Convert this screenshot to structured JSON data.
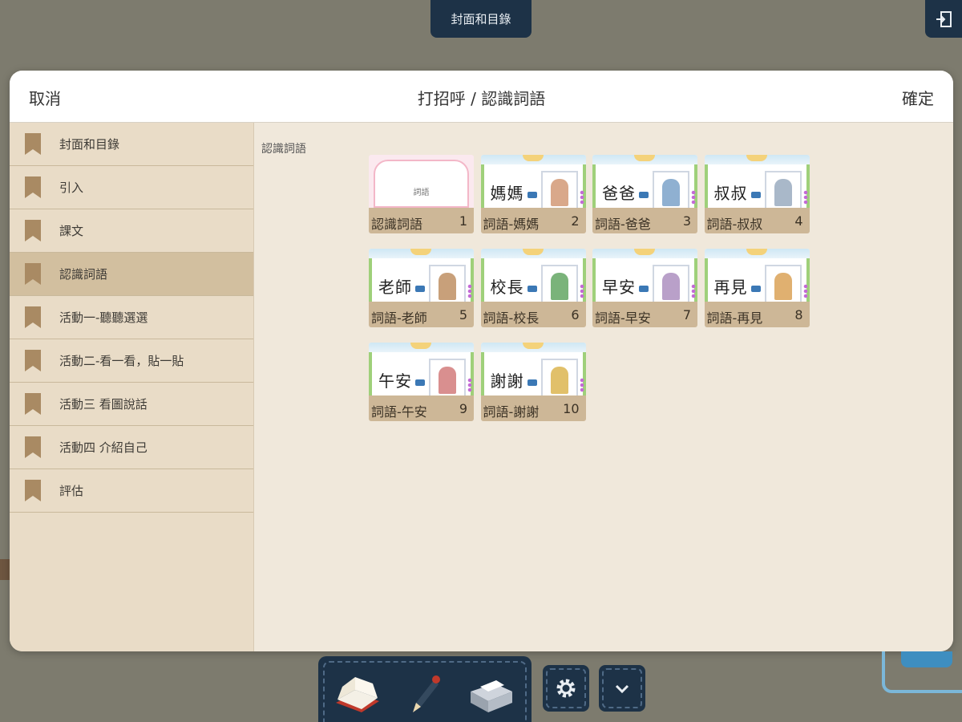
{
  "app": {
    "top_tab": "封面和目錄"
  },
  "modal": {
    "cancel": "取消",
    "title": "打招呼 / 認識詞語",
    "confirm": "確定"
  },
  "sidebar": {
    "items": [
      {
        "label": "封面和目錄",
        "active": false
      },
      {
        "label": "引入",
        "active": false
      },
      {
        "label": "課文",
        "active": false
      },
      {
        "label": "認識詞語",
        "active": true
      },
      {
        "label": "活動一-聽聽選選",
        "active": false
      },
      {
        "label": "活動二-看一看，貼一貼",
        "active": false
      },
      {
        "label": "活動三 看圖說話",
        "active": false
      },
      {
        "label": "活動四 介紹自己",
        "active": false
      },
      {
        "label": "評估",
        "active": false
      }
    ]
  },
  "content": {
    "section_label": "認識詞語",
    "pages": [
      {
        "caption": "認識詞語",
        "num": "1",
        "word": "",
        "cover_text": "詞語"
      },
      {
        "caption": "詞語-媽媽",
        "num": "2",
        "word": "媽媽"
      },
      {
        "caption": "詞語-爸爸",
        "num": "3",
        "word": "爸爸"
      },
      {
        "caption": "詞語-叔叔",
        "num": "4",
        "word": "叔叔"
      },
      {
        "caption": "詞語-老師",
        "num": "5",
        "word": "老師"
      },
      {
        "caption": "詞語-校長",
        "num": "6",
        "word": "校長"
      },
      {
        "caption": "詞語-早安",
        "num": "7",
        "word": "早安"
      },
      {
        "caption": "詞語-再見",
        "num": "8",
        "word": "再見"
      },
      {
        "caption": "詞語-午安",
        "num": "9",
        "word": "午安"
      },
      {
        "caption": "詞語-謝謝",
        "num": "10",
        "word": "謝謝"
      }
    ]
  },
  "colors": {
    "accent_navy": "#1d3247",
    "bookmark": "#a98a63",
    "active_row": "#d2bf9f",
    "caption_bg": "#cdb797"
  },
  "icons": [
    "exit-icon",
    "bookmark-icon",
    "book-icon",
    "pen-icon",
    "printer-icon",
    "gear-icon",
    "chevron-down-icon"
  ]
}
